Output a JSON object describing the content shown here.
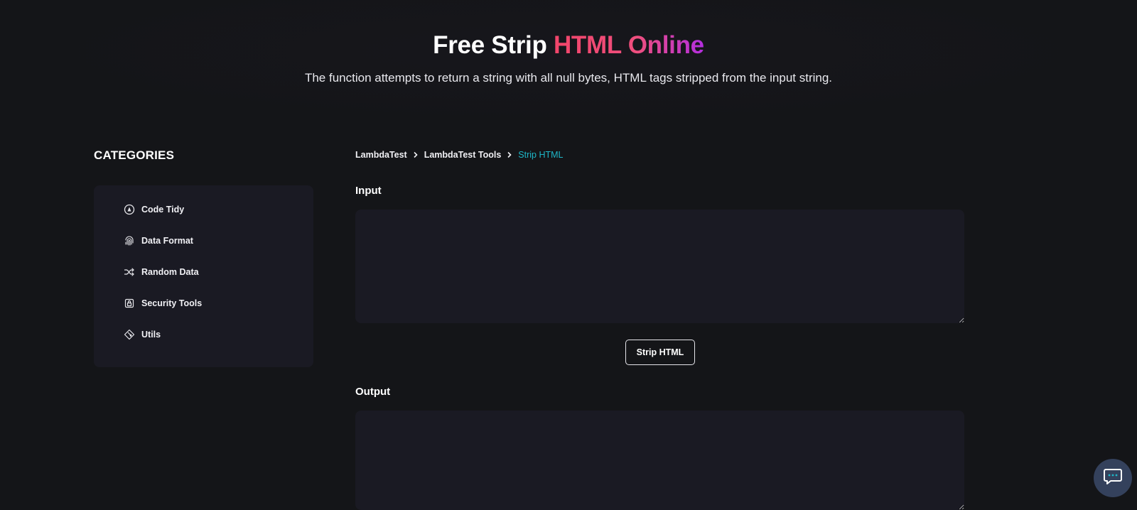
{
  "hero": {
    "title_plain": "Free Strip ",
    "title_accent": "HTML Online",
    "subtitle": "The function attempts to return a string with all null bytes, HTML tags stripped from the input string.",
    "accent_gradient": [
      "#f2456a",
      "#ef4f7e",
      "#b32ee0"
    ]
  },
  "sidebar": {
    "title": "CATEGORIES",
    "items": [
      {
        "label": "Code Tidy",
        "icon": "code-tidy-icon"
      },
      {
        "label": "Data Format",
        "icon": "fingerprint-icon"
      },
      {
        "label": "Random Data",
        "icon": "shuffle-icon"
      },
      {
        "label": "Security Tools",
        "icon": "lock-icon"
      },
      {
        "label": "Utils",
        "icon": "git-diamond-icon"
      }
    ]
  },
  "breadcrumb": {
    "items": [
      "LambdaTest",
      "LambdaTest Tools"
    ],
    "current": "Strip HTML",
    "current_color": "#1eb7c8"
  },
  "main": {
    "input_label": "Input",
    "input_value": "",
    "action_button": "Strip HTML",
    "output_label": "Output",
    "output_value": ""
  },
  "chat": {
    "icon": "chat-icon",
    "background": "#34415c"
  }
}
